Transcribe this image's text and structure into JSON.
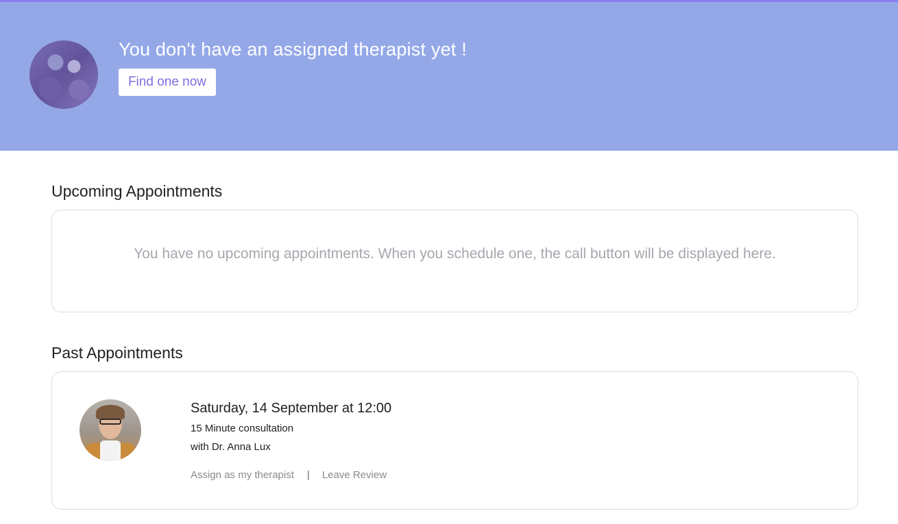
{
  "hero": {
    "title": "You don't have an assigned therapist yet !",
    "find_button": "Find one now",
    "background_color": "#94a8e8",
    "accent_color": "#8a7ef0"
  },
  "upcoming": {
    "heading": "Upcoming Appointments",
    "empty_message": "You have no upcoming appointments. When you schedule one, the call button will be displayed here."
  },
  "past": {
    "heading": "Past Appointments",
    "appointments": [
      {
        "date": "Saturday, 14 September at 12:00",
        "type": "15 Minute consultation",
        "with": "with Dr. Anna Lux",
        "assign_label": "Assign as my therapist",
        "separator": "|",
        "review_label": "Leave Review"
      }
    ]
  }
}
